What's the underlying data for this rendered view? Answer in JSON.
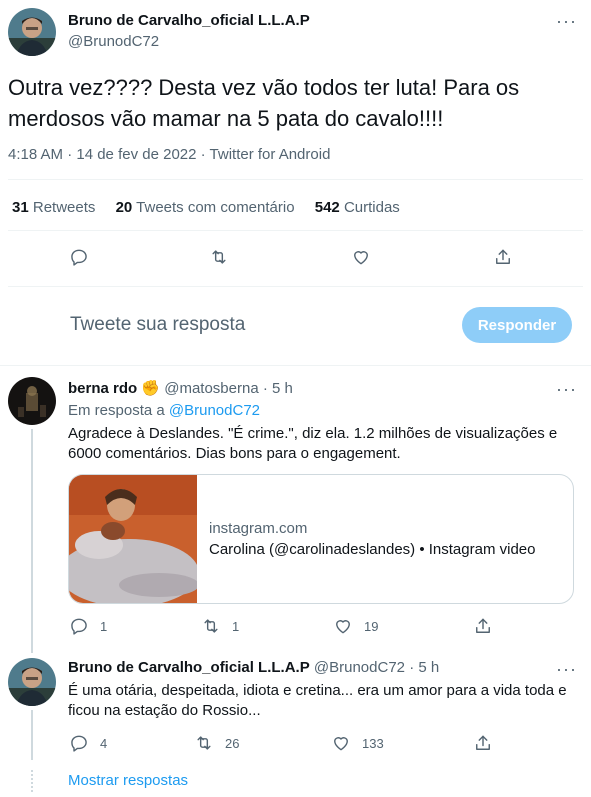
{
  "main_tweet": {
    "author_name": "Bruno de Carvalho_oficial L.L.A.P",
    "author_handle": "@BrunodC72",
    "text": "Outra vez???? Desta vez vão todos ter luta! Para os merdosos vão mamar na 5 pata do cavalo!!!!",
    "meta": "4:18 AM · 14 de fev de 2022 · Twitter for Android",
    "retweets_count": "31",
    "retweets_label": "Retweets",
    "quotes_count": "20",
    "quotes_label": "Tweets com comentário",
    "likes_count": "542",
    "likes_label": "Curtidas"
  },
  "compose": {
    "placeholder": "Tweete sua resposta",
    "button_label": "Responder",
    "button_color": "#8ecdf8"
  },
  "reply1": {
    "author_name": "berna rdo",
    "emoji": "✊",
    "author_handle": "@matosberna",
    "time": "· 5 h",
    "reply_to_prefix": "Em resposta a",
    "reply_to_handle": "@BrunodC72",
    "text": "Agradece à Deslandes. \"É crime.\", diz ela. 1.2 milhões de visualizações e 6000 comentários. Dias bons para o engagement.",
    "card": {
      "domain": "instagram.com",
      "title": "Carolina (@carolinadeslandes) • Instagram video"
    },
    "replies": "1",
    "retweets": "1",
    "likes": "19"
  },
  "reply2": {
    "author_name": "Bruno de Carvalho_oficial L.L.A.P",
    "author_handle": "@BrunodC72",
    "time": "· 5 h",
    "text": "É uma otária, despeitada, idiota e cretina... era um amor para a vida toda e ficou na estação do Rossio...",
    "replies": "4",
    "retweets": "26",
    "likes": "133"
  },
  "show_replies_label": "Mostrar respostas",
  "accent_color": "#1d9bf0"
}
